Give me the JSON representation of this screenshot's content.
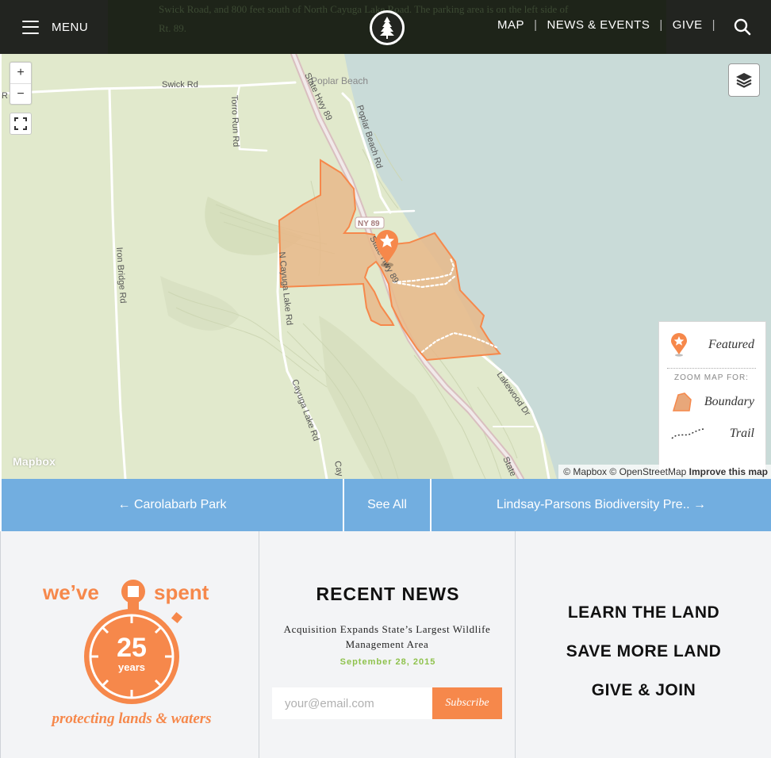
{
  "header": {
    "menu_label": "MENU",
    "behind_text_line1": "Swick Road, and 800 feet south of North Cayuga Lake Road. The parking area is on the left side of",
    "behind_text_line2": "Rt. 89.",
    "nav": [
      {
        "label": "MAP"
      },
      {
        "label": "NEWS & EVENTS"
      },
      {
        "label": "GIVE"
      }
    ],
    "icons": {
      "menu": "hamburger-icon",
      "logo": "tree-logo-icon",
      "search": "search-icon"
    }
  },
  "map": {
    "zoom_in": "+",
    "zoom_out": "−",
    "labels": {
      "swick_rd": "Swick Rd",
      "poplar_beach": "Poplar Beach",
      "poplar_beach_rd": "Poplar Beach Rd",
      "state_hwy_89": "State Hwy 89",
      "state_hwy_89_b": "State Hwy 89",
      "state_hwy_89_c": "State",
      "torro_run_rd": "Torro Run Rd",
      "iron_bridge_rd": "Iron Bridge Rd",
      "n_cayuga_lake_rd": "N Cayuga Lake Rd",
      "cayuga_lake_rd": "Cayuga Lake Rd",
      "cayuga_frag": "Cay",
      "lakewood_dr": "Lakewood Dr",
      "ny89_shield": "NY 89",
      "edge_r": "R"
    },
    "legend": {
      "featured": "Featured",
      "zoom_for": "ZOOM MAP FOR:",
      "boundary": "Boundary",
      "trail": "Trail"
    },
    "mapbox_logo": "Mapbox",
    "attribution": {
      "mapbox": "© Mapbox",
      "osm": "© OpenStreetMap",
      "improve": "Improve this map"
    },
    "colors": {
      "land": "#e1e9cc",
      "water": "#c9dbd8",
      "boundary_fill": "#e8b98a",
      "boundary_stroke": "#f6884b"
    }
  },
  "pager": {
    "prev": "← Carolabarb Park",
    "all": "See All",
    "next": "Lindsay-Parsons Biodiversity Pre.. →"
  },
  "badge": {
    "top_left": "we’ve",
    "top_right": "spent",
    "number": "25",
    "unit": "years",
    "tagline": "protecting lands & waters"
  },
  "news": {
    "title": "RECENT NEWS",
    "item": "Acquisition Expands State’s Largest Wildlife Management Area",
    "date": "September 28, 2015",
    "email_placeholder": "your@email.com",
    "subscribe": "Subscribe"
  },
  "cta": [
    {
      "label": "LEARN THE LAND"
    },
    {
      "label": "SAVE MORE LAND"
    },
    {
      "label": "GIVE & JOIN"
    }
  ],
  "accent_colors": {
    "orange": "#f6884b",
    "green": "#8fc24d",
    "blue": "#72aee0",
    "dark": "#222420"
  }
}
